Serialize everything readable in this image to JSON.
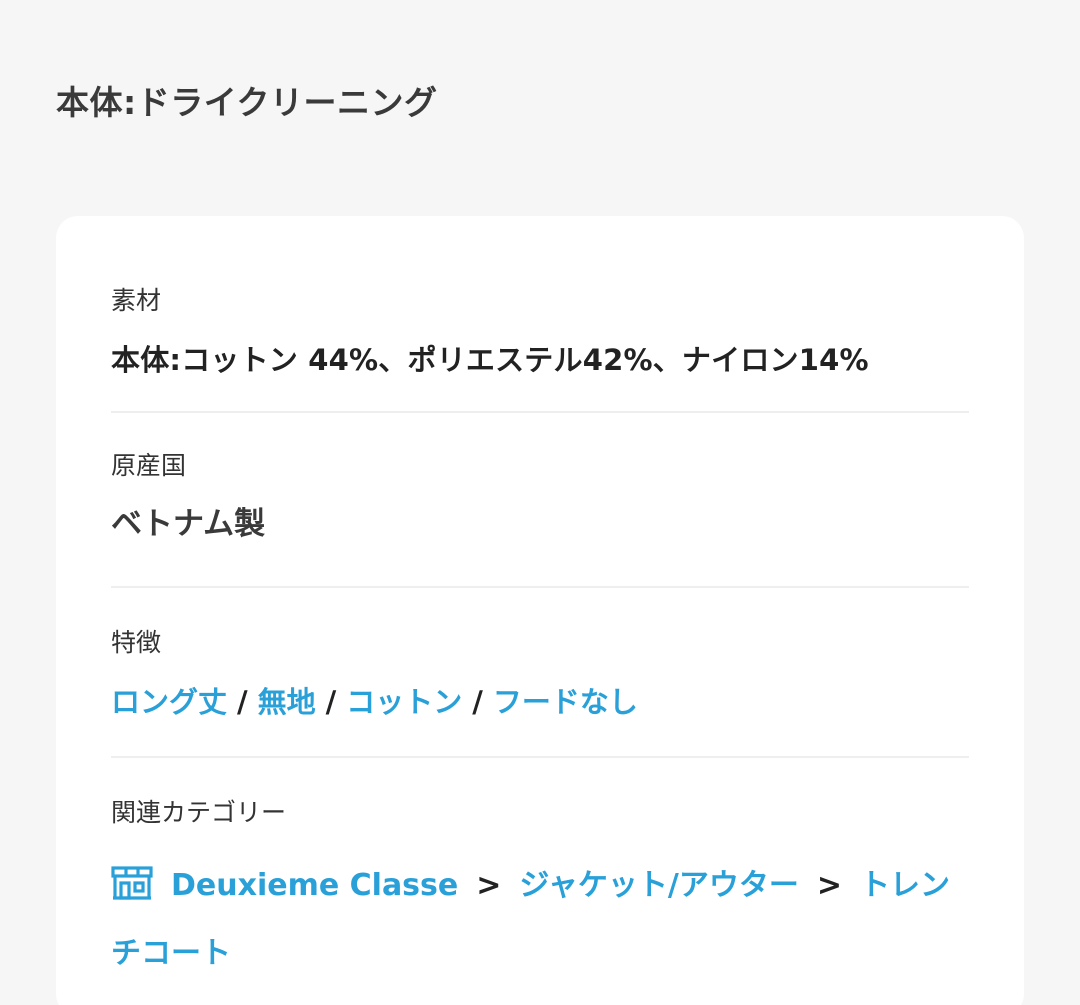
{
  "care": "本体:ドライクリーニング",
  "material": {
    "label": "素材",
    "value": "本体:コットン 44%、ポリエステル42%、ナイロン14%"
  },
  "origin": {
    "label": "原産国",
    "value": "ベトナム製"
  },
  "features": {
    "label": "特徴",
    "separator": "/",
    "items": [
      "ロング丈",
      "無地",
      "コットン",
      "フードなし"
    ]
  },
  "categories": {
    "label": "関連カテゴリー",
    "icon": "shop-icon",
    "separator": ">",
    "items": [
      "Deuxieme Classe",
      "ジャケット/アウター",
      "トレンチコート"
    ]
  },
  "colors": {
    "link": "#2aa0d8",
    "background": "#f6f6f6",
    "card": "#ffffff"
  }
}
